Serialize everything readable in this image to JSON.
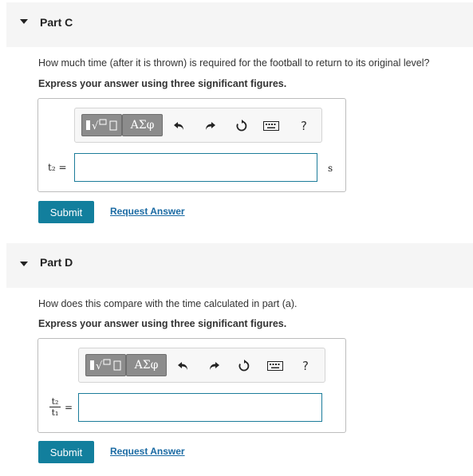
{
  "part_c": {
    "title": "Part C",
    "question": "How much time (after it is thrown) is required for the football to return to its original level?",
    "instruction": "Express your answer using three significant figures.",
    "variable": "t₂ =",
    "input_value": "",
    "unit": "s",
    "greek_label": "ΑΣφ",
    "help_label": "?",
    "submit_label": "Submit",
    "request_label": "Request Answer"
  },
  "part_d": {
    "title": "Part D",
    "question": "How does this compare with the time calculated in part (a).",
    "instruction": "Express your answer using three significant figures.",
    "frac_num": "t₂",
    "frac_den": "t₁",
    "equals": "=",
    "input_value": "",
    "greek_label": "ΑΣφ",
    "help_label": "?",
    "submit_label": "Submit",
    "request_label": "Request Answer"
  },
  "icons": {
    "caret": "caret-down-icon",
    "template": "template-sqrt-icon",
    "undo": "undo-icon",
    "redo": "redo-icon",
    "reset": "reset-icon",
    "keyboard": "keyboard-icon",
    "help": "help-icon"
  },
  "colors": {
    "submit_bg": "#127f9d",
    "link": "#1a6aa3",
    "input_border": "#1c7c9a",
    "toolbar_button": "#8c8c8c",
    "header_bg": "#f5f5f5"
  }
}
